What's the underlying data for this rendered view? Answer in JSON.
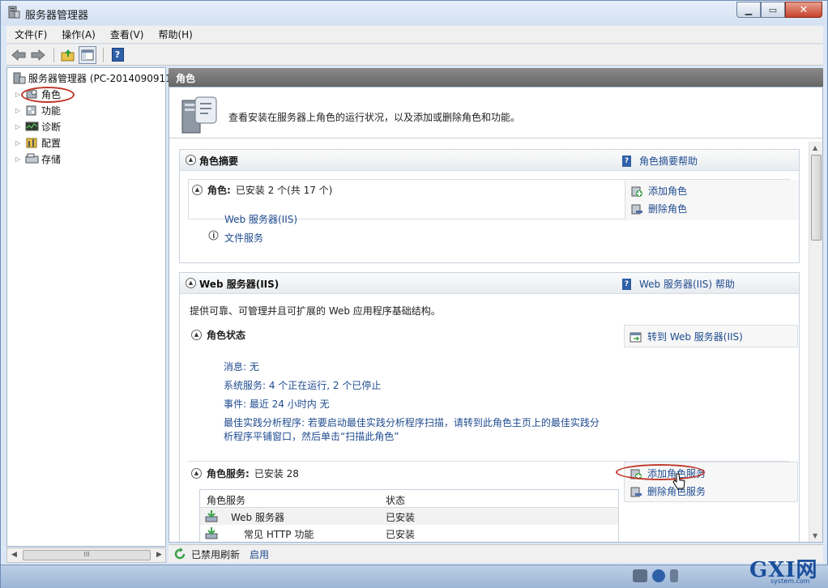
{
  "window": {
    "title": "服务器管理器"
  },
  "menu": [
    "文件(F)",
    "操作(A)",
    "查看(V)",
    "帮助(H)"
  ],
  "tree": {
    "root": "服务器管理器 (PC-2014090911",
    "items": [
      {
        "label": "角色",
        "icon": "roles-icon"
      },
      {
        "label": "功能",
        "icon": "features-icon"
      },
      {
        "label": "诊断",
        "icon": "diagnostics-icon"
      },
      {
        "label": "配置",
        "icon": "configuration-icon"
      },
      {
        "label": "存储",
        "icon": "storage-icon"
      }
    ],
    "scroll_glyph": "III"
  },
  "pane": {
    "header": "角色",
    "intro": "查看安装在服务器上角色的运行状况，以及添加或删除角色和功能。",
    "summary": {
      "title": "角色摘要",
      "help": "角色摘要帮助",
      "roles_label": "角色:",
      "roles_value": "已安装 2 个(共 17 个)",
      "role_links": [
        "Web 服务器(IIS)",
        "文件服务"
      ],
      "add_role": "添加角色",
      "remove_role": "删除角色"
    },
    "iis": {
      "title": "Web 服务器(IIS)",
      "help": "Web 服务器(IIS) 帮助",
      "description": "提供可靠、可管理并且可扩展的 Web 应用程序基础结构。",
      "status_title": "角色状态",
      "goto": "转到 Web 服务器(IIS)",
      "messages": "消息: 无",
      "services": "系统服务: 4 个正在运行, 2 个已停止",
      "events": "事件: 最近 24 小时内 无",
      "bpa_line1": "最佳实践分析程序: 若要启动最佳实践分析程序扫描，请转到此角色主页上的最佳实践分",
      "bpa_line2": "析程序平铺窗口，然后单击“扫描此角色”",
      "role_services_title": "角色服务:",
      "role_services_value": "已安装 28",
      "add_role_services": "添加角色服务",
      "remove_role_services": "删除角色服务",
      "table": {
        "headers": [
          "角色服务",
          "状态"
        ],
        "rows": [
          {
            "name": "Web 服务器",
            "status": "已安装"
          },
          {
            "name": "常见 HTTP 功能",
            "status": "已安装"
          }
        ]
      }
    }
  },
  "statusbar": {
    "text": "已禁用刷新",
    "link": "启用"
  },
  "watermark": {
    "main": "GXI网",
    "sub": "system.com"
  },
  "colors": {
    "link": "#1f4b8f",
    "header": "#6e6e6e",
    "highlight": "#c0392b"
  }
}
